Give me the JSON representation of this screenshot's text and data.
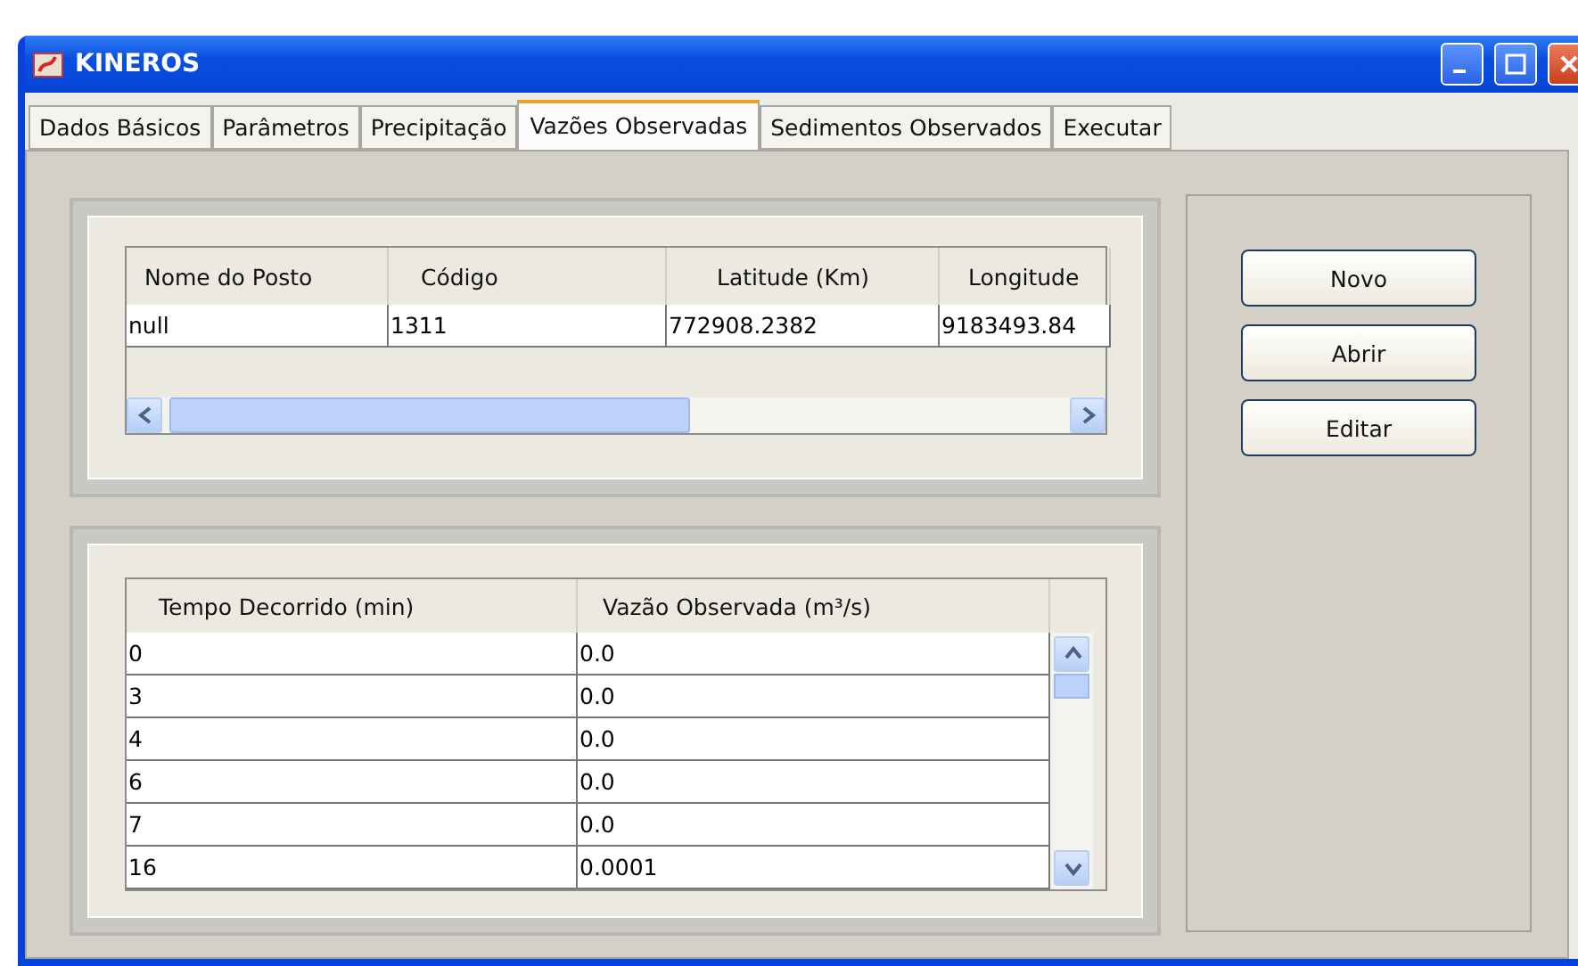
{
  "window": {
    "title": "KINEROS"
  },
  "tabs": [
    {
      "label": "Dados Básicos",
      "selected": false
    },
    {
      "label": "Parâmetros",
      "selected": false
    },
    {
      "label": "Precipitação",
      "selected": false
    },
    {
      "label": "Vazões Observadas",
      "selected": true
    },
    {
      "label": "Sedimentos Observados",
      "selected": false
    },
    {
      "label": "Executar",
      "selected": false
    }
  ],
  "stations_table": {
    "columns": [
      "Nome do Posto",
      "Código",
      "Latitude (Km)",
      "Longitude"
    ],
    "rows": [
      [
        "null",
        "1311",
        "772908.2382",
        "9183493.84"
      ]
    ]
  },
  "flow_table": {
    "columns": [
      "Tempo Decorrido (min)",
      "Vazão Observada (m³/s)"
    ],
    "rows": [
      [
        "0",
        "0.0"
      ],
      [
        "3",
        "0.0"
      ],
      [
        "4",
        "0.0"
      ],
      [
        "6",
        "0.0"
      ],
      [
        "7",
        "0.0"
      ],
      [
        "16",
        "0.0001"
      ]
    ]
  },
  "buttons": [
    "Novo",
    "Abrir",
    "Editar"
  ]
}
